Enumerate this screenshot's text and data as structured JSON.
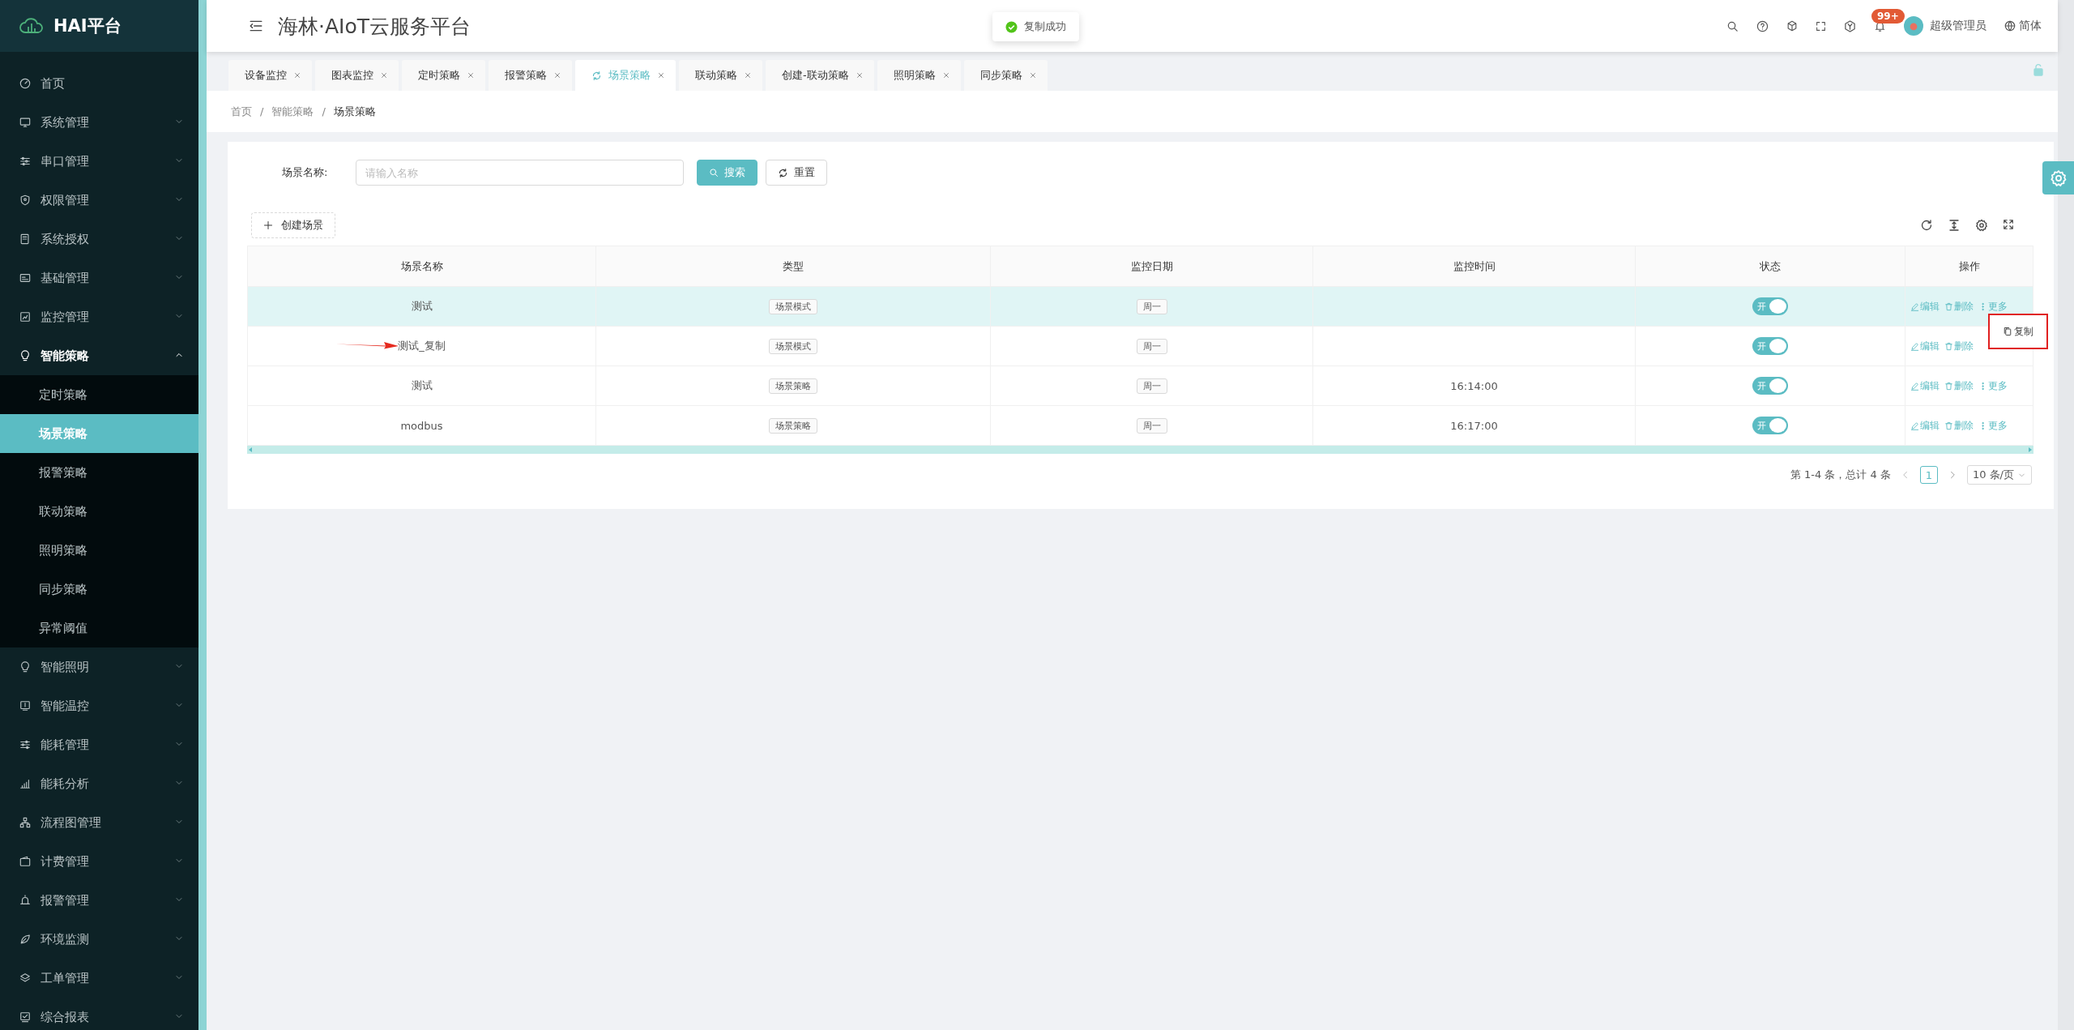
{
  "sidebar": {
    "logo": "HAI平台",
    "items": [
      {
        "label": "首页"
      },
      {
        "label": "系统管理",
        "expanded": false
      },
      {
        "label": "串口管理",
        "expanded": false
      },
      {
        "label": "权限管理",
        "expanded": false
      },
      {
        "label": "系统授权",
        "expanded": false
      },
      {
        "label": "基础管理",
        "expanded": false
      },
      {
        "label": "监控管理",
        "expanded": false
      },
      {
        "label": "智能策略",
        "expanded": true,
        "children": [
          {
            "label": "定时策略",
            "selected": false
          },
          {
            "label": "场景策略",
            "selected": true
          },
          {
            "label": "报警策略",
            "selected": false
          },
          {
            "label": "联动策略",
            "selected": false
          },
          {
            "label": "照明策略",
            "selected": false
          },
          {
            "label": "同步策略",
            "selected": false
          },
          {
            "label": "异常阈值",
            "selected": false
          }
        ]
      },
      {
        "label": "智能照明",
        "expanded": false
      },
      {
        "label": "智能温控",
        "expanded": false
      },
      {
        "label": "能耗管理",
        "expanded": false
      },
      {
        "label": "能耗分析",
        "expanded": false
      },
      {
        "label": "流程图管理",
        "expanded": false
      },
      {
        "label": "计费管理",
        "expanded": false
      },
      {
        "label": "报警管理",
        "expanded": false
      },
      {
        "label": "环境监测",
        "expanded": false
      },
      {
        "label": "工单管理",
        "expanded": false
      },
      {
        "label": "综合报表",
        "expanded": false
      }
    ]
  },
  "header": {
    "title": "海林·AIoT云服务平台",
    "notification_badge": "99+",
    "user": "超级管理员",
    "language": "简体"
  },
  "toast": {
    "message": "复制成功"
  },
  "tabs": [
    {
      "label": "设备监控",
      "selected": false
    },
    {
      "label": "图表监控",
      "selected": false
    },
    {
      "label": "定时策略",
      "selected": false
    },
    {
      "label": "报警策略",
      "selected": false
    },
    {
      "label": "场景策略",
      "selected": true
    },
    {
      "label": "联动策略",
      "selected": false
    },
    {
      "label": "创建-联动策略",
      "selected": false
    },
    {
      "label": "照明策略",
      "selected": false
    },
    {
      "label": "同步策略",
      "selected": false
    }
  ],
  "breadcrumb": {
    "items": [
      "首页",
      "智能策略",
      "场景策略"
    ],
    "separator": "/"
  },
  "search": {
    "label": "场景名称:",
    "placeholder": "请输入名称",
    "search_button": "搜索",
    "reset_button": "重置"
  },
  "create_button": "创建场景",
  "table": {
    "columns": [
      "场景名称",
      "类型",
      "监控日期",
      "监控时间",
      "状态",
      "操作"
    ],
    "rows": [
      {
        "name": "测试",
        "type": "场景模式",
        "date": "周一",
        "time": "",
        "status": {
          "on": true,
          "label": "开"
        },
        "actions": [
          "编辑",
          "删除",
          "更多"
        ],
        "hovered": true
      },
      {
        "name": "测试_复制",
        "type": "场景模式",
        "date": "周一",
        "time": "",
        "status": {
          "on": true,
          "label": "开"
        },
        "actions": [
          "编辑",
          "删除"
        ],
        "hovered": false
      },
      {
        "name": "测试",
        "type": "场景策略",
        "date": "周一",
        "time": "16:14:00",
        "status": {
          "on": true,
          "label": "开"
        },
        "actions": [
          "编辑",
          "删除",
          "更多"
        ],
        "hovered": false
      },
      {
        "name": "modbus",
        "type": "场景策略",
        "date": "周一",
        "time": "16:17:00",
        "status": {
          "on": true,
          "label": "开"
        },
        "actions": [
          "编辑",
          "删除",
          "更多"
        ],
        "hovered": false
      }
    ]
  },
  "more_menu": {
    "item": "复制"
  },
  "pagination": {
    "summary": "第 1-4 条，总计 4 条",
    "page": "1",
    "page_size": "10 条/页"
  }
}
